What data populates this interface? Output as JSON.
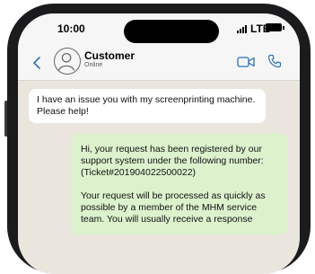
{
  "status_bar": {
    "time": "10:00",
    "network": "LTE"
  },
  "header": {
    "contact_name": "Customer",
    "contact_status": "Online"
  },
  "messages": [
    {
      "direction": "incoming",
      "text": "I have an issue you with my screenprinting machine. Please help!"
    },
    {
      "direction": "outgoing",
      "paragraphs": [
        "Hi, your request has been registered by our support system under the following number: (Ticket#201904022500022)",
        "Your request will be processed as quickly as possible by a member of the MHM service team. You will usually receive a response"
      ]
    }
  ],
  "icons": {
    "back": "chevron-left-icon",
    "avatar": "user-icon",
    "video": "video-camera-icon",
    "call": "phone-icon"
  },
  "colors": {
    "accent": "#2f6fb5",
    "incoming_bubble": "#ffffff",
    "outgoing_bubble": "#dcf2cd",
    "chat_background": "#eae6dd"
  }
}
